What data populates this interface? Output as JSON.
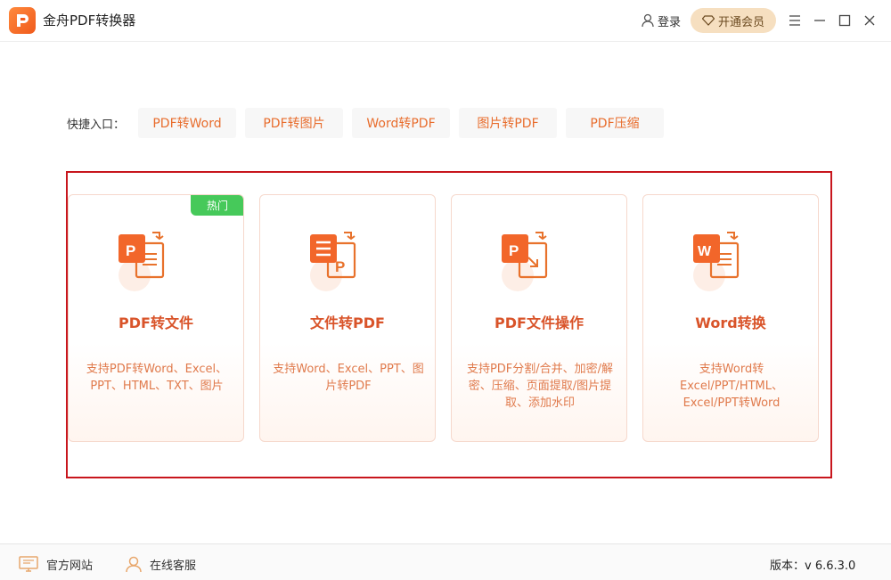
{
  "app": {
    "title": "金舟PDF转换器"
  },
  "titlebar": {
    "login_label": "登录",
    "vip_label": "开通会员",
    "icons": [
      "user-icon",
      "diamond-icon",
      "menu-icon",
      "minimize-icon",
      "maximize-icon",
      "close-icon"
    ]
  },
  "quick": {
    "label": "快捷入口：",
    "items": [
      {
        "label": "PDF转Word"
      },
      {
        "label": "PDF转图片"
      },
      {
        "label": "Word转PDF"
      },
      {
        "label": "图片转PDF"
      },
      {
        "label": "PDF压缩"
      }
    ]
  },
  "cards": [
    {
      "title": "PDF转文件",
      "desc": "支持PDF转Word、Excel、PPT、HTML、TXT、图片",
      "badge": "热门",
      "icon": "pdf-to-file-icon"
    },
    {
      "title": "文件转PDF",
      "desc": "支持Word、Excel、PPT、图片转PDF",
      "icon": "file-to-pdf-icon"
    },
    {
      "title": "PDF文件操作",
      "desc": "支持PDF分割/合并、加密/解密、压缩、页面提取/图片提取、添加水印",
      "icon": "pdf-operations-icon"
    },
    {
      "title": "Word转换",
      "desc": "支持Word转Excel/PPT/HTML、Excel/PPT转Word",
      "icon": "word-convert-icon"
    }
  ],
  "footer": {
    "website_label": "官方网站",
    "service_label": "在线客服",
    "version_label": "版本：v 6.6.3.0"
  },
  "colors": {
    "accent": "#e86d2d",
    "card_title": "#d9542a",
    "highlight": "#c8161d",
    "hot": "#46c95a",
    "vip": "#f6dfc0"
  }
}
